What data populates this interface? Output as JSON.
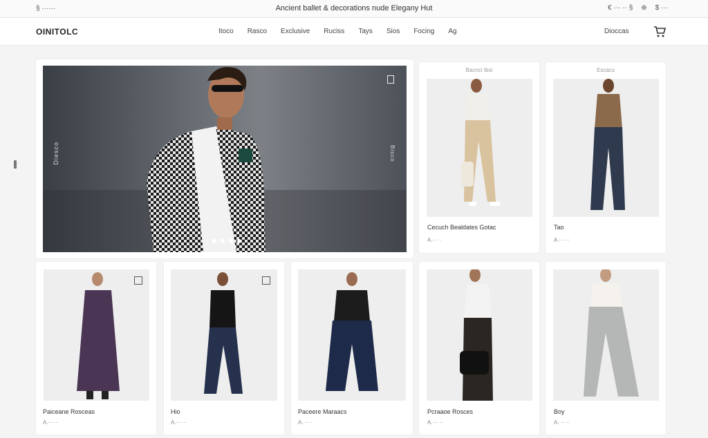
{
  "topbar": {
    "left_text": "§ ······",
    "center_text": "Ancient ballet & decorations nude Elegany Hut",
    "right_items": [
      "€ ··· ·· §",
      "⊕",
      "$ ···"
    ]
  },
  "nav": {
    "logo": "OINITOLC",
    "menu": [
      "Itoco",
      "Rasco",
      "Exclusive",
      "Ruciss",
      "Tays",
      "Sios",
      "Focing",
      "Ag"
    ],
    "account": "Dioccas"
  },
  "hero": {
    "left_vertical": "Diesco",
    "right_vertical": "Bisco",
    "dots": 4
  },
  "top_products": [
    {
      "tag": "Bacnci Ibsi",
      "title": "Cecuch Bealdates Gotac",
      "price": "A.··· ·"
    },
    {
      "tag": "Escacs",
      "title": "Tao",
      "price": "A.··· ··"
    }
  ],
  "bottom_products": [
    {
      "title": "Paiceane Rosceas",
      "price": "A.··· ··"
    },
    {
      "title": "Hio",
      "price": "A.··· ··"
    },
    {
      "title": "Paceere Maraacs",
      "price": "A.··· ·"
    },
    {
      "title": "Pcraaoe Rosces",
      "price": "A.··· ··"
    },
    {
      "title": "Boy",
      "price": "A.··· ··"
    }
  ]
}
